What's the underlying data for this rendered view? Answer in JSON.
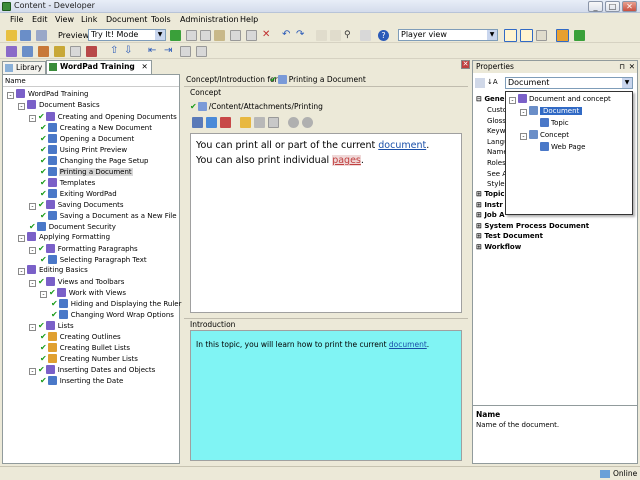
{
  "window": {
    "title": "Content - Developer",
    "min": "_",
    "max": "□",
    "close": "✕"
  },
  "menu": [
    "File",
    "Edit",
    "View",
    "Link",
    "Document",
    "Tools",
    "Administration",
    "Help"
  ],
  "toolbar": {
    "preview_label": "Preview:",
    "preview_mode": "Try It! Mode",
    "player_view": "Player view"
  },
  "tabs": {
    "library": "Library",
    "wordpad": "WordPad Training"
  },
  "tree": {
    "header": "Name",
    "items": [
      {
        "label": "WordPad Training",
        "depth": 0,
        "exp": "-",
        "check": false,
        "icon": "book"
      },
      {
        "label": "Document Basics",
        "depth": 1,
        "exp": "-",
        "check": false,
        "icon": "book"
      },
      {
        "label": "Creating and Opening Documents",
        "depth": 2,
        "exp": "-",
        "check": true,
        "icon": "book"
      },
      {
        "label": "Creating a New Document",
        "depth": 3,
        "exp": "",
        "check": true,
        "icon": "topic"
      },
      {
        "label": "Opening a Document",
        "depth": 3,
        "exp": "",
        "check": true,
        "icon": "topic"
      },
      {
        "label": "Using Print Preview",
        "depth": 3,
        "exp": "",
        "check": true,
        "icon": "topic"
      },
      {
        "label": "Changing the Page Setup",
        "depth": 3,
        "exp": "",
        "check": true,
        "icon": "topic"
      },
      {
        "label": "Printing a Document",
        "depth": 3,
        "exp": "",
        "check": true,
        "icon": "topic",
        "selected": true
      },
      {
        "label": "Templates",
        "depth": 3,
        "exp": "",
        "check": true,
        "icon": "book"
      },
      {
        "label": "Exiting WordPad",
        "depth": 3,
        "exp": "",
        "check": true,
        "icon": "topic"
      },
      {
        "label": "Saving Documents",
        "depth": 2,
        "exp": "-",
        "check": true,
        "icon": "book"
      },
      {
        "label": "Saving a Document as a New File",
        "depth": 3,
        "exp": "",
        "check": true,
        "icon": "topic"
      },
      {
        "label": "Document Security",
        "depth": 2,
        "exp": "",
        "check": true,
        "icon": "topic"
      },
      {
        "label": "Applying Formatting",
        "depth": 1,
        "exp": "-",
        "check": false,
        "icon": "book"
      },
      {
        "label": "Formatting Paragraphs",
        "depth": 2,
        "exp": "-",
        "check": true,
        "icon": "book"
      },
      {
        "label": "Selecting Paragraph Text",
        "depth": 3,
        "exp": "",
        "check": true,
        "icon": "topic"
      },
      {
        "label": "Editing Basics",
        "depth": 1,
        "exp": "-",
        "check": false,
        "icon": "book"
      },
      {
        "label": "Views and Toolbars",
        "depth": 2,
        "exp": "-",
        "check": true,
        "icon": "book"
      },
      {
        "label": "Work with Views",
        "depth": 3,
        "exp": "-",
        "check": true,
        "icon": "book"
      },
      {
        "label": "Hiding and Displaying the Ruler",
        "depth": 4,
        "exp": "",
        "check": true,
        "icon": "topic"
      },
      {
        "label": "Changing Word Wrap Options",
        "depth": 4,
        "exp": "",
        "check": true,
        "icon": "topic"
      },
      {
        "label": "Lists",
        "depth": 2,
        "exp": "-",
        "check": true,
        "icon": "book"
      },
      {
        "label": "Creating Outlines",
        "depth": 3,
        "exp": "",
        "check": true,
        "icon": "orange"
      },
      {
        "label": "Creating Bullet Lists",
        "depth": 3,
        "exp": "",
        "check": true,
        "icon": "orange"
      },
      {
        "label": "Creating Number Lists",
        "depth": 3,
        "exp": "",
        "check": true,
        "icon": "orange"
      },
      {
        "label": "Inserting Dates and Objects",
        "depth": 2,
        "exp": "-",
        "check": true,
        "icon": "book"
      },
      {
        "label": "Inserting the Date",
        "depth": 3,
        "exp": "",
        "check": true,
        "icon": "topic"
      }
    ]
  },
  "center": {
    "concept_for_label": "Concept/Introduction for:",
    "concept_for_doc": "Printing a Document",
    "concept_section": "Concept",
    "path": "/Content/Attachments/Printing",
    "line1_pre": "You can print all or part of the current ",
    "line1_link": "document",
    "line1_post": ".",
    "line2_pre": "You can also print individual ",
    "line2_link": "pages",
    "line2_post": ".",
    "intro_section": "Introduction",
    "intro_pre": "In this topic, you will learn how to print the current ",
    "intro_link": "document",
    "intro_post": "."
  },
  "properties": {
    "title": "Properties",
    "dropdown_value": "Document",
    "groups": [
      "Gene",
      "Topic",
      "Instr",
      "Job A",
      "System Process Document",
      "Test Document",
      "Workflow"
    ],
    "fields": [
      "Custo",
      "Glossa",
      "Keywo",
      "Langu",
      "Name",
      "Roles",
      "See Al",
      "Style S"
    ],
    "popup": [
      {
        "label": "Document and concept",
        "depth": 0
      },
      {
        "label": "Document",
        "depth": 1,
        "selected": true
      },
      {
        "label": "Topic",
        "depth": 2
      },
      {
        "label": "Concept",
        "depth": 1
      },
      {
        "label": "Web Page",
        "depth": 2
      }
    ],
    "desc_title": "Name",
    "desc_text": "Name of the document."
  },
  "status": {
    "online": "Online"
  },
  "colors": {
    "intro_bg": "#80f4f4",
    "link": "#1a4fa8",
    "check": "#1a9b1a",
    "selected_blue": "#316ac5"
  }
}
